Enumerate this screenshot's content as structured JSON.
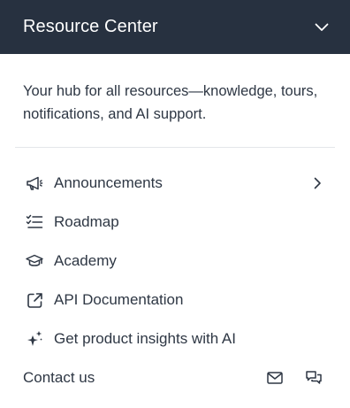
{
  "header": {
    "title": "Resource Center",
    "collapse_icon": "chevron-down-icon",
    "background": "#273140",
    "text_color": "#ffffff"
  },
  "intro": {
    "text": "Your hub for all resources—knowledge, tours, notifications, and AI support."
  },
  "menu": {
    "items": [
      {
        "label": "Announcements",
        "icon": "megaphone-icon",
        "has_submenu": true
      },
      {
        "label": "Roadmap",
        "icon": "checklist-icon",
        "has_submenu": false
      },
      {
        "label": "Academy",
        "icon": "graduation-cap-icon",
        "has_submenu": false
      },
      {
        "label": "API Documentation",
        "icon": "external-link-icon",
        "has_submenu": false
      },
      {
        "label": "Get product insights with AI",
        "icon": "sparkles-icon",
        "has_submenu": false
      }
    ]
  },
  "contact": {
    "label": "Contact us",
    "icons": [
      "mail-icon",
      "chat-icon"
    ]
  },
  "colors": {
    "text": "#2e3744",
    "divider": "#e4e6ea"
  }
}
